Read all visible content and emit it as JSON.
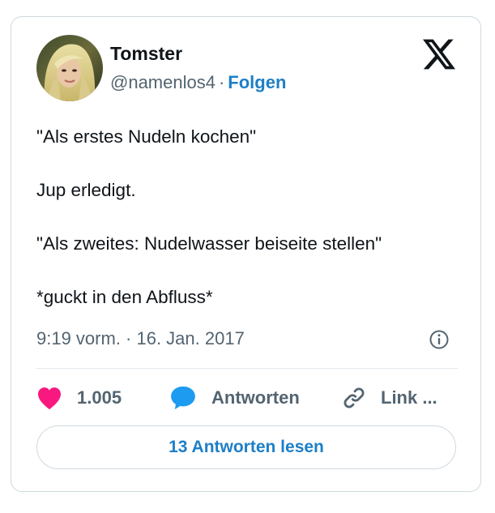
{
  "author": {
    "name": "Tomster",
    "handle": "@namenlos4",
    "separator": "·",
    "follow_label": "Folgen"
  },
  "tweet": {
    "lines": [
      "\"Als erstes Nudeln kochen\"",
      "Jup erledigt.",
      "\"Als zweites: Nudelwasser beiseite stellen\"",
      "*guckt in den Abfluss*"
    ],
    "timestamp": "9:19 vorm. · 16. Jan. 2017"
  },
  "actions": {
    "likes": "1.005",
    "reply_label": "Antworten",
    "copy_label": "Link ..."
  },
  "read_replies_label": "13 Antworten lesen",
  "icons": {
    "platform": "x-logo-icon",
    "info": "info-icon",
    "like": "heart-icon",
    "reply": "speech-bubble-icon",
    "copy": "link-icon"
  },
  "colors": {
    "accent": "#1d7fc7",
    "like": "#f91880",
    "reply": "#1d9bf0",
    "muted": "#536471",
    "text": "#0f1419",
    "border": "#cfd9de"
  }
}
